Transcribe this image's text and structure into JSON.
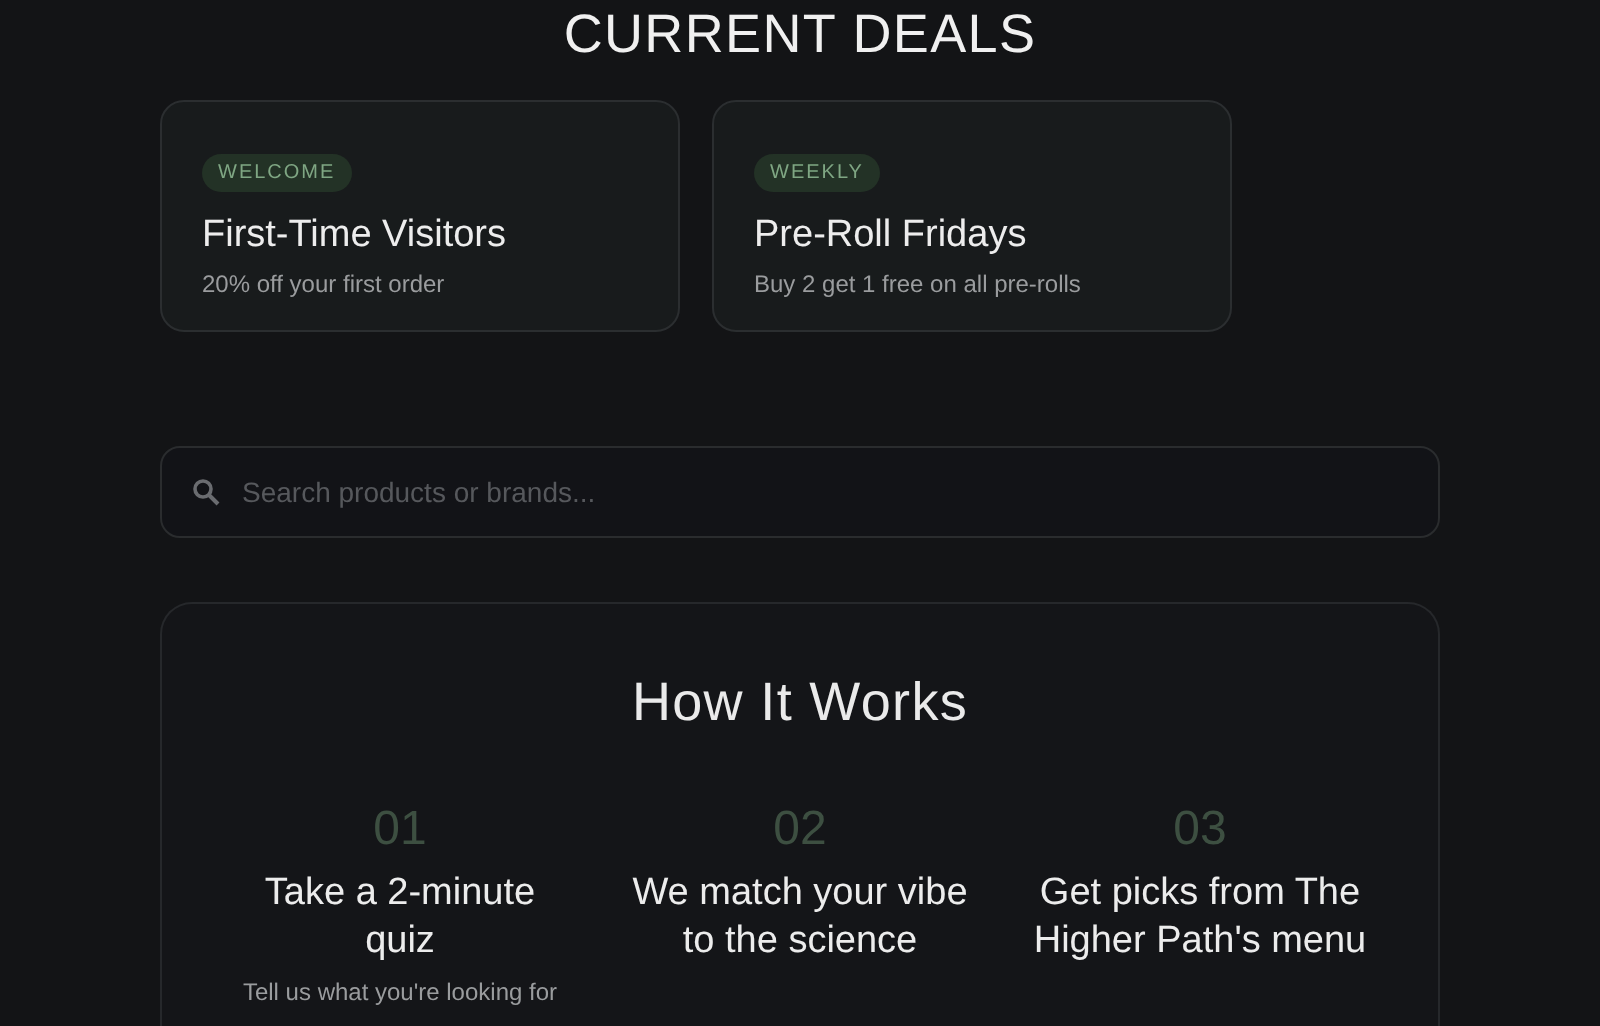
{
  "heading": "CURRENT DEALS",
  "deals": [
    {
      "tag": "WELCOME",
      "title": "First-Time Visitors",
      "subtitle": "20% off your first order"
    },
    {
      "tag": "WEEKLY",
      "title": "Pre-Roll Fridays",
      "subtitle": "Buy 2 get 1 free on all pre-rolls"
    }
  ],
  "search": {
    "placeholder": "Search products or brands..."
  },
  "how_it_works": {
    "title": "How It Works",
    "steps": [
      {
        "number": "01",
        "title": "Take a 2-minute quiz",
        "description": "Tell us what you're looking for"
      },
      {
        "number": "02",
        "title": "We match your vibe to the science"
      },
      {
        "number": "03",
        "title": "Get picks from The Higher Path's menu"
      }
    ]
  }
}
